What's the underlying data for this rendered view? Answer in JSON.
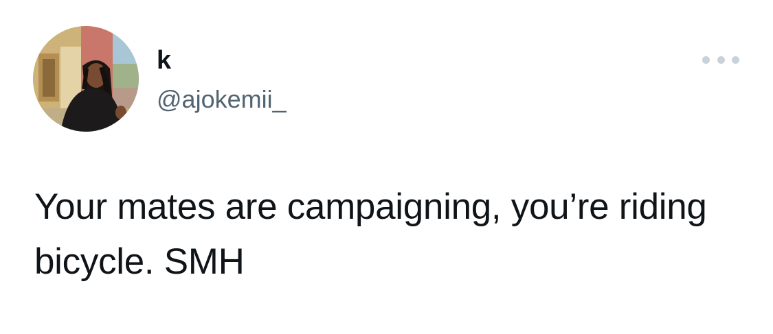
{
  "tweet": {
    "author": {
      "display_name": "k",
      "handle": "@ajokemii_",
      "avatar": "profile-photo"
    },
    "more_icon": "more-horizontal-icon",
    "text": "Your mates are campaigning, you’re riding bicycle. SMH"
  }
}
